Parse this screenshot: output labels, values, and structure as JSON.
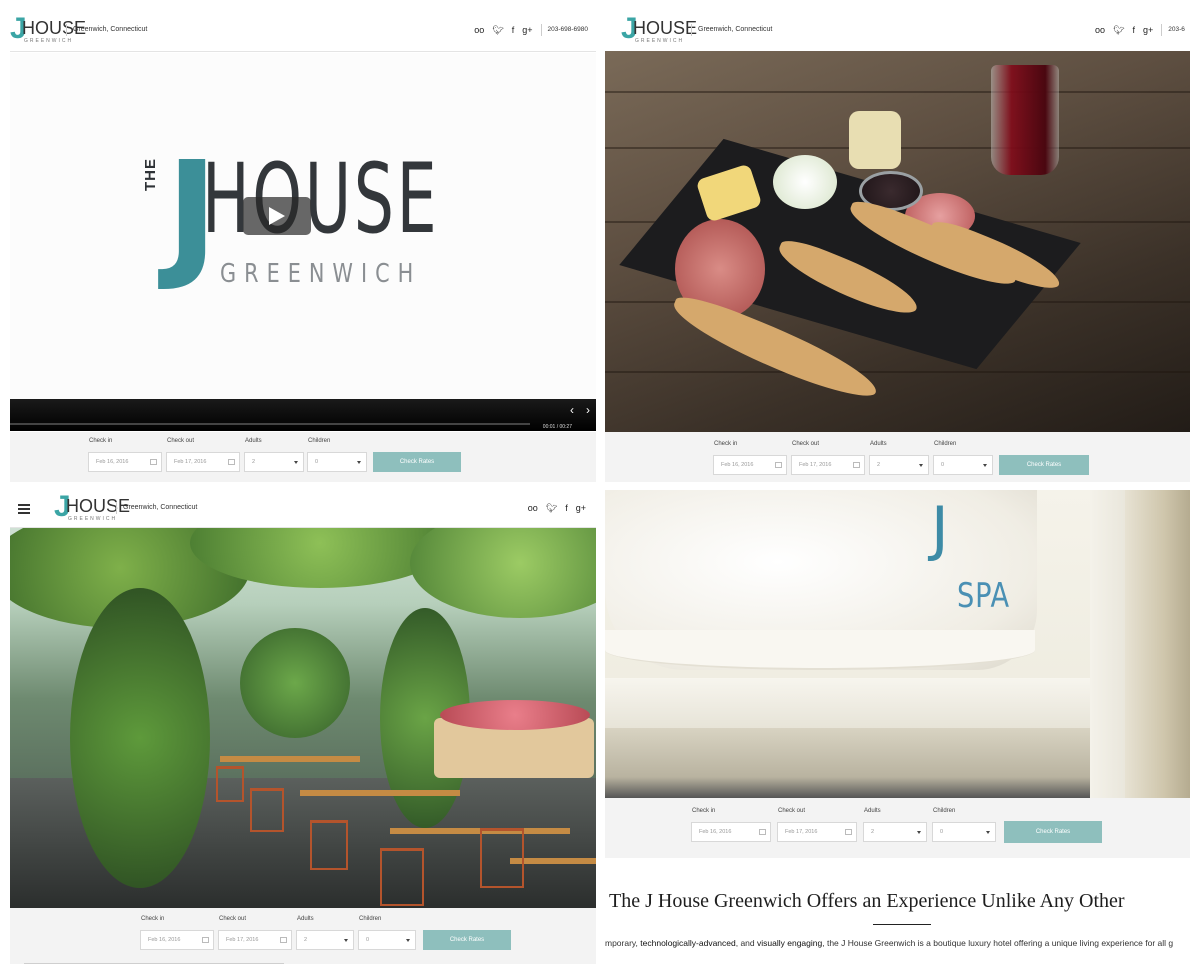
{
  "brand": {
    "the": "THE",
    "j": "J",
    "house": "HOUSE",
    "greenwich": "GREENWICH",
    "location": "Greenwich, Connecticut",
    "phone": "203-698-6980",
    "phone_cropped": "203-6"
  },
  "social": {
    "tripadvisor": "oo",
    "twitter": "•",
    "facebook": "f",
    "googleplus": "g+"
  },
  "video": {
    "time": "00:01 / 00:27",
    "prev": "‹",
    "next": "›"
  },
  "booking": {
    "checkin_label": "Check in",
    "checkout_label": "Check out",
    "adults_label": "Adults",
    "children_label": "Children",
    "checkin_value": "Feb 16, 2016",
    "checkout_value": "Feb 17, 2016",
    "adults_value": "2",
    "children_value": "0",
    "button": "Check Rates"
  },
  "spa": {
    "mark": "J",
    "text": "SPA"
  },
  "content": {
    "headline": "The J House Greenwich Offers an Experience Unlike Any Other",
    "intro_start": "mporary, ",
    "intro_b1": "technologically-advanced",
    "intro_mid": ", and ",
    "intro_b2": "visually engaging",
    "intro_end": ", the J House Greenwich is a boutique luxury hotel offering a unique living experience for all g"
  },
  "colors": {
    "teal": "#3ba5a5",
    "button": "#8ebfbd",
    "booking_bg": "#f3f3f3"
  }
}
